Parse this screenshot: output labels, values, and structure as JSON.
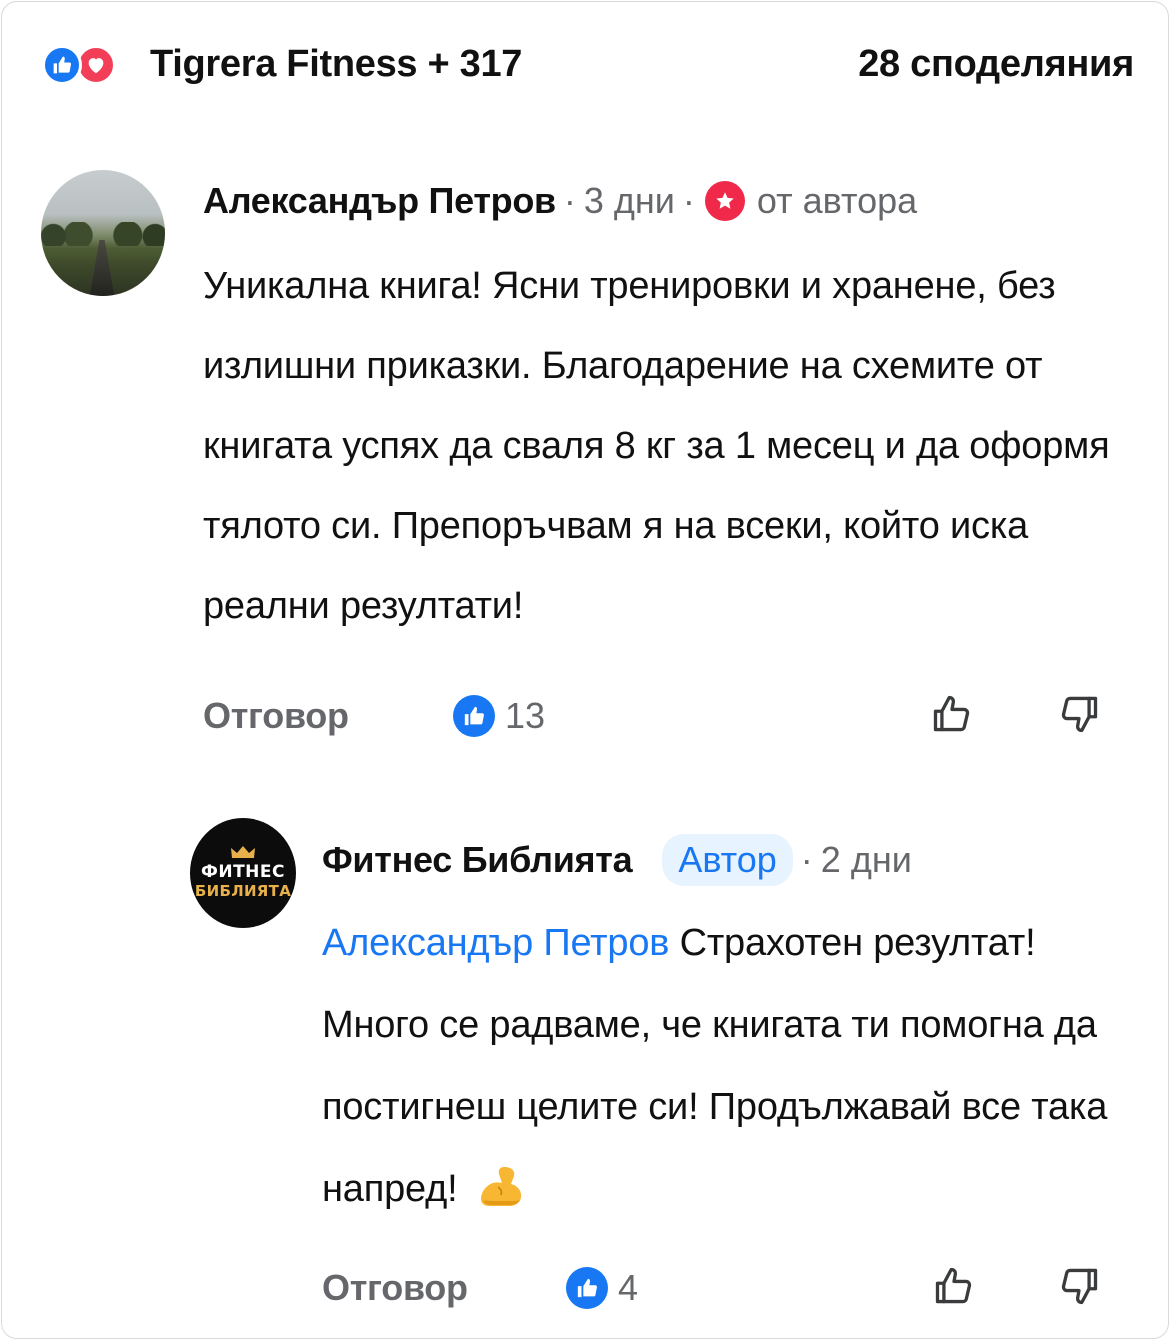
{
  "header": {
    "reactions": [
      "like-icon",
      "love-icon"
    ],
    "reactors_text": "Tigrera Fitness + 317",
    "shares_text": "28 споделяния"
  },
  "comment": {
    "author": "Александър Петров",
    "time": "3 дни",
    "badge_icon": "star-badge-icon",
    "badge_label": "от автора",
    "text": "Уникална книга! Ясни тренировки и хранене, без излишни приказки. Благодарение на схемите от книгата успях да сваля 8 кг за 1 месец и да оформя тялото си. Препоръчвам я на всеки, който иска реални резултати!",
    "reply_label": "Отговор",
    "like_count": "13"
  },
  "reply": {
    "avatar_line1": "ФИТНЕС",
    "avatar_line2": "БИБЛИЯТА",
    "author": "Фитнес Библията",
    "author_badge": "Автор",
    "time": "2 дни",
    "mention": "Александър Петров",
    "text": "Страхотен резултат! Много се радваме, че книгата ти помогна да постигнеш целите си! Продължавай все така напред!",
    "emoji_icon": "flexed-biceps-icon",
    "reply_label": "Отговор",
    "like_count": "4"
  },
  "colors": {
    "like_blue": "#1877f2",
    "love_red": "#f33e58",
    "muted_text": "#65676b",
    "author_pill_bg": "#e7f3ff"
  }
}
